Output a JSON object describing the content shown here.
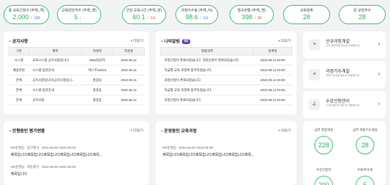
{
  "stats": [
    {
      "label": "총 교육신청수 (주체_개)",
      "main": "2,000",
      "sub": "120",
      "sub_color": "blue"
    },
    {
      "label": "교육담당자수 (주체_명)",
      "main": "5",
      "sub": "-",
      "sub_color": "grey"
    },
    {
      "label": "인당 교육시간 (주체_분)",
      "main": "60.1",
      "sub": "0.5",
      "sub_color": "red"
    },
    {
      "label": "과정이수율 (주체_%)",
      "main": "98.6",
      "sub": "0.5",
      "sub_color": "blue"
    },
    {
      "label": "접속현황 (주체_명)",
      "main": "398",
      "sub": "50",
      "sub_color": "red"
    },
    {
      "label": "교육컴퓨",
      "main": "28"
    },
    {
      "label": "문 교담자수",
      "main": "28"
    }
  ],
  "notice": {
    "title": "공지사항",
    "more": "+ 더보기",
    "headers": [
      "구분",
      "제목",
      "작성자",
      "작성일"
    ],
    "rows": [
      [
        "시스템",
        "교육시스템 공지사항입니다.",
        "DNS담당자",
        "2022.06.11"
      ],
      [
        "채용관련",
        "시스템 점검안내",
        "테스트53513",
        "2022.06.11"
      ],
      [
        "전체",
        "공지사항입니다(공지사항입니...",
        "홍길동",
        "2022.06.11"
      ],
      [
        "전체",
        "시스템 점검안내",
        "홍길동",
        "2022.06.11"
      ],
      [
        "전체",
        "공지사항",
        "홍길동",
        "2022.06.11"
      ]
    ]
  },
  "messages": {
    "title": "나의알림",
    "badge": "60",
    "more": "+ 더보기",
    "headers": [
      "알림내역",
      "등록일"
    ],
    "rows": [
      [
        "과정신청이 완료되었습니다. 과정신청이 완료되었습니다.",
        "2022.06.11 00:00"
      ],
      [
        "직급별 교육 과정에 합격하셨습니다.",
        "2022.06.11 00:00"
      ],
      [
        "과정신청이 완료되었습니다.",
        "2022.06.11 00:00"
      ],
      [
        "직급별 교육 과정에 합격하셨습니다.",
        "2022.06.11 00:00"
      ],
      [
        "과정신청이 완료되었습니다.",
        "2022.06.11 00:00"
      ]
    ]
  },
  "eval": {
    "title": "진행중인 평가현황",
    "more": "+ 더보기",
    "items": [
      {
        "meta": "HR문영팀 · 중간평가 · 2022.06.00~2022.06.00",
        "text": "제목입니다제목입니다제목입니다제목입니다제목입니다제목..."
      },
      {
        "meta": "HR문영팀 · 최종평가 · 2022.06.00~2022.06.00",
        "text": "제목입니다"
      }
    ]
  },
  "courses": {
    "title": "운영중인 교육과정",
    "more": "+ 더보기",
    "items": [
      {
        "meta": "HR문영팀 · 2022.06.00~2022.06.00",
        "text": "제목입니다제목입니다제목입니다제목입니다제목입니다제목..."
      }
    ]
  },
  "quick": [
    {
      "icon": "≡",
      "title": "신규과정개설",
      "desc": "신규 과정개설 메뉴로 이동합니다",
      "arrow": "›"
    },
    {
      "icon": "≡",
      "title": "과정기수개설",
      "desc": "과정기수개설 메뉴로 이동합니다",
      "arrow": "›"
    },
    {
      "icon": "∠",
      "title": "수강신청관리",
      "desc": "수강신청관리 메뉴로 이동합니다",
      "arrow": "›"
    }
  ],
  "summary": [
    {
      "label": "금주 과정개설",
      "value": "228"
    },
    {
      "label": "금주 과정기수개설",
      "value": "28"
    },
    {
      "label": "수강신청자",
      "value": "200"
    },
    {
      "label": "수료/미수료",
      "value": "5"
    }
  ]
}
